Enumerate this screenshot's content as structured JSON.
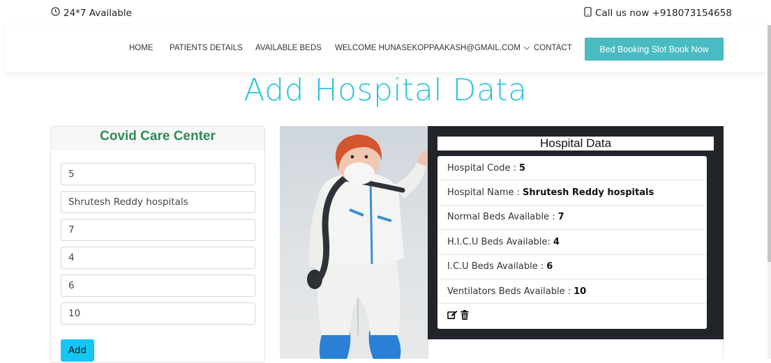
{
  "topbar": {
    "availability": "24*7 Available",
    "call": "Call us now +918073154658"
  },
  "nav": {
    "items": [
      "HOME",
      "PATIENTS DETAILS",
      "AVAILABLE BEDS",
      "WELCOME HUNASEKOPPAAKASH@GMAIL.COM",
      "CONTACT"
    ],
    "book_button": "Bed Booking Slot Book Now"
  },
  "page_title": "Add Hospital Data",
  "form": {
    "header": "Covid Care Center",
    "fields": [
      "5",
      "Shrutesh Reddy hospitals",
      "7",
      "4",
      "6",
      "10"
    ],
    "add_label": "Add"
  },
  "hospital": {
    "title": "Hospital Data",
    "rows": [
      {
        "label": "Hospital Code : ",
        "value": "5"
      },
      {
        "label": "Hospital Name : ",
        "value": "Shrutesh Reddy hospitals"
      },
      {
        "label": "Normal Beds Available :",
        "value": "7"
      },
      {
        "label": "H.I.C.U Beds Available: ",
        "value": "4"
      },
      {
        "label": "I.C.U Beds Available :",
        "value": "6"
      },
      {
        "label": "Ventilators Beds Available : ",
        "value": "10"
      }
    ]
  },
  "colors": {
    "accent": "#2bc2de",
    "book_button": "#48bcc2",
    "add_button": "#14c7f2",
    "form_header": "#2e8b57",
    "dark_panel": "#212529"
  },
  "icons": {
    "availability": "clock-icon",
    "call": "phone-icon",
    "dropdown": "chevron-down-icon",
    "edit": "edit-icon",
    "delete": "trash-icon"
  }
}
